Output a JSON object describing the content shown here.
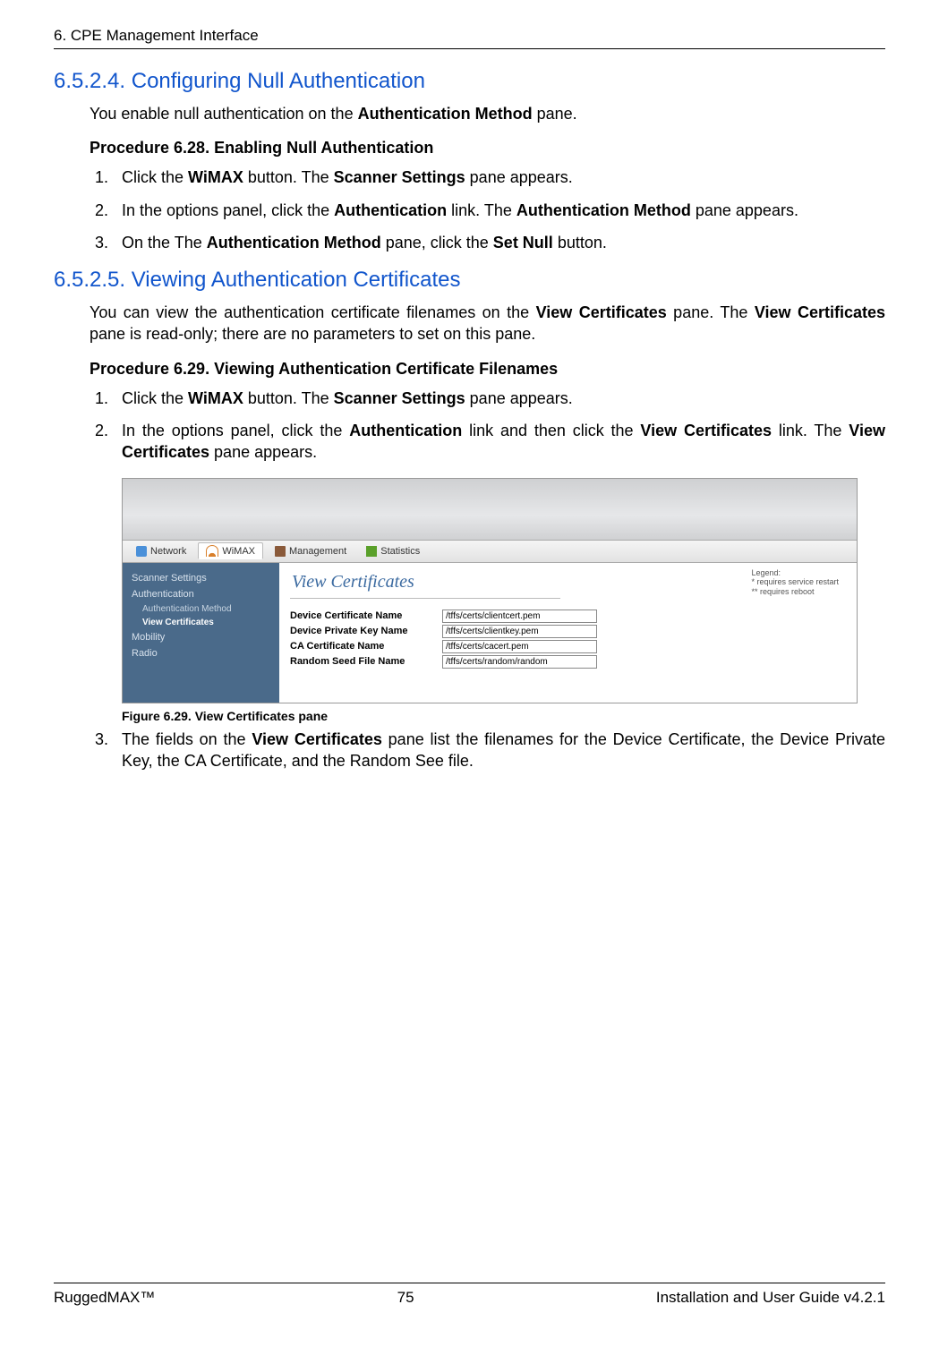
{
  "header": "6. CPE Management Interface",
  "section_6524": {
    "title": "6.5.2.4. Configuring Null Authentication",
    "intro_pre": "You enable null authentication on the ",
    "intro_bold": "Authentication Method",
    "intro_post": " pane.",
    "procedure_title": "Procedure 6.28. Enabling Null Authentication",
    "steps": {
      "s1_pre": "Click the ",
      "s1_b1": "WiMAX",
      "s1_mid": " button. The ",
      "s1_b2": "Scanner Settings",
      "s1_post": " pane appears.",
      "s2_pre": "In the options panel, click the ",
      "s2_b1": "Authentication",
      "s2_mid": " link. The ",
      "s2_b2": "Authentication Method",
      "s2_post": " pane appears.",
      "s3_pre": "On the The ",
      "s3_b1": "Authentication Method",
      "s3_mid": " pane, click the ",
      "s3_b2": "Set Null",
      "s3_post": " button."
    }
  },
  "section_6525": {
    "title": "6.5.2.5. Viewing Authentication Certificates",
    "intro_pre": "You can view the authentication certificate filenames on the ",
    "intro_b1": "View Certificates",
    "intro_mid": " pane. The ",
    "intro_b2": "View Certificates",
    "intro_post": " pane is read-only; there are no parameters to set on this pane.",
    "procedure_title": "Procedure 6.29. Viewing Authentication Certificate Filenames",
    "steps": {
      "s1_pre": "Click the ",
      "s1_b1": "WiMAX",
      "s1_mid": " button. The ",
      "s1_b2": "Scanner Settings",
      "s1_post": " pane appears.",
      "s2_pre": "In the options panel, click the ",
      "s2_b1": "Authentication",
      "s2_mid": " link and then click the ",
      "s2_b2": "View Certificates",
      "s2_post": " link. The ",
      "s2_b3": "View Certificates",
      "s2_end": " pane appears.",
      "s3_pre": "The fields on the ",
      "s3_b1": "View Certificates",
      "s3_post": " pane list the filenames for the Device Certificate, the Device Private Key, the CA Certificate, and the Random See file."
    }
  },
  "figure": {
    "caption": "Figure 6.29. View Certificates pane",
    "tabs": {
      "network": "Network",
      "wimax": "WiMAX",
      "management": "Management",
      "statistics": "Statistics"
    },
    "sidebar": {
      "scanner": "Scanner Settings",
      "auth": "Authentication",
      "auth_method": "Authentication Method",
      "view_certs": "View Certificates",
      "mobility": "Mobility",
      "radio": "Radio"
    },
    "pane_title": "View Certificates",
    "legend": {
      "title": "Legend:",
      "l1": "*  requires service restart",
      "l2": "** requires reboot"
    },
    "rows": {
      "dev_cert_label": "Device Certificate Name",
      "dev_cert_val": "/tffs/certs/clientcert.pem",
      "dev_key_label": "Device Private Key Name",
      "dev_key_val": "/tffs/certs/clientkey.pem",
      "ca_cert_label": "CA Certificate Name",
      "ca_cert_val": "/tffs/certs/cacert.pem",
      "rand_label": "Random Seed File Name",
      "rand_val": "/tffs/certs/random/random"
    }
  },
  "footer": {
    "left": "RuggedMAX™",
    "center": "75",
    "right": "Installation and User Guide v4.2.1"
  }
}
